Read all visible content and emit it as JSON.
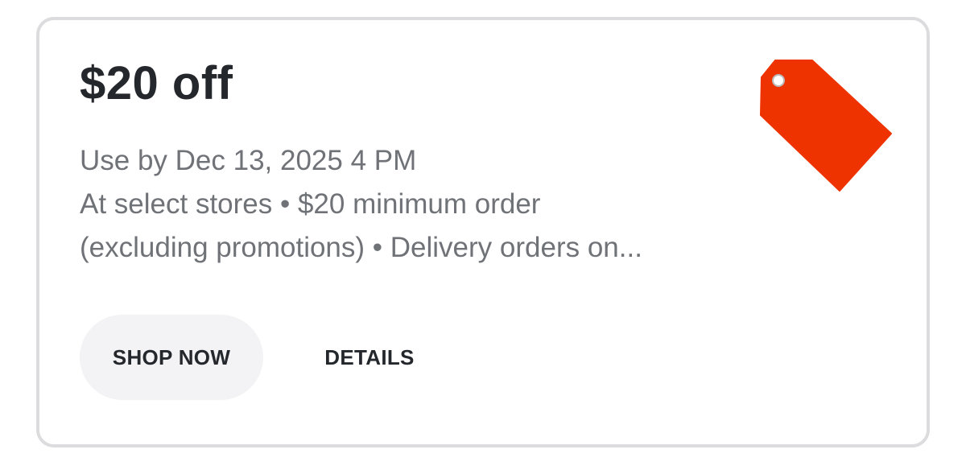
{
  "offer": {
    "title": "$20 off",
    "expiry": "Use by Dec 13, 2025 4 PM",
    "terms_line1": "At select stores • $20 minimum order",
    "terms_line2": "(excluding promotions) • Delivery orders on..."
  },
  "icon": {
    "name": "price-tag-icon",
    "color": "#ee3300"
  },
  "actions": {
    "shop_now_label": "SHOP NOW",
    "details_label": "DETAILS"
  },
  "colors": {
    "title": "#24272c",
    "body_text": "#6f7277",
    "card_border": "#dcdcde",
    "button_bg": "#f3f3f5"
  }
}
